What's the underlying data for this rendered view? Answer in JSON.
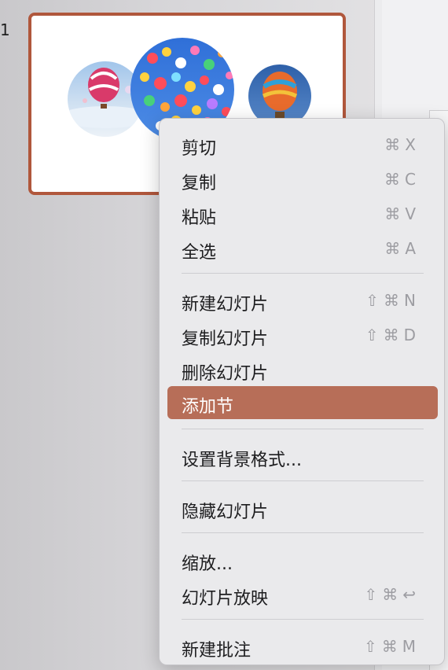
{
  "slide": {
    "number": "1"
  },
  "menu": {
    "items": [
      {
        "label": "剪切",
        "shortcut": "⌘X"
      },
      {
        "label": "复制",
        "shortcut": "⌘C"
      },
      {
        "label": "粘贴",
        "shortcut": "⌘V"
      },
      {
        "label": "全选",
        "shortcut": "⌘A"
      },
      {
        "label": "新建幻灯片",
        "shortcut": "⇧⌘N"
      },
      {
        "label": "复制幻灯片",
        "shortcut": "⇧⌘D"
      },
      {
        "label": "删除幻灯片",
        "shortcut": ""
      },
      {
        "label": "添加节",
        "shortcut": ""
      },
      {
        "label": "设置背景格式...",
        "shortcut": ""
      },
      {
        "label": "隐藏幻灯片",
        "shortcut": ""
      },
      {
        "label": "缩放...",
        "shortcut": ""
      },
      {
        "label": "幻灯片放映",
        "shortcut": "⇧⌘↩"
      },
      {
        "label": "新建批注",
        "shortcut": "⇧⌘M"
      }
    ]
  },
  "colors": {
    "accent": "#b76e58",
    "thumbnail_border": "#b0573c"
  }
}
